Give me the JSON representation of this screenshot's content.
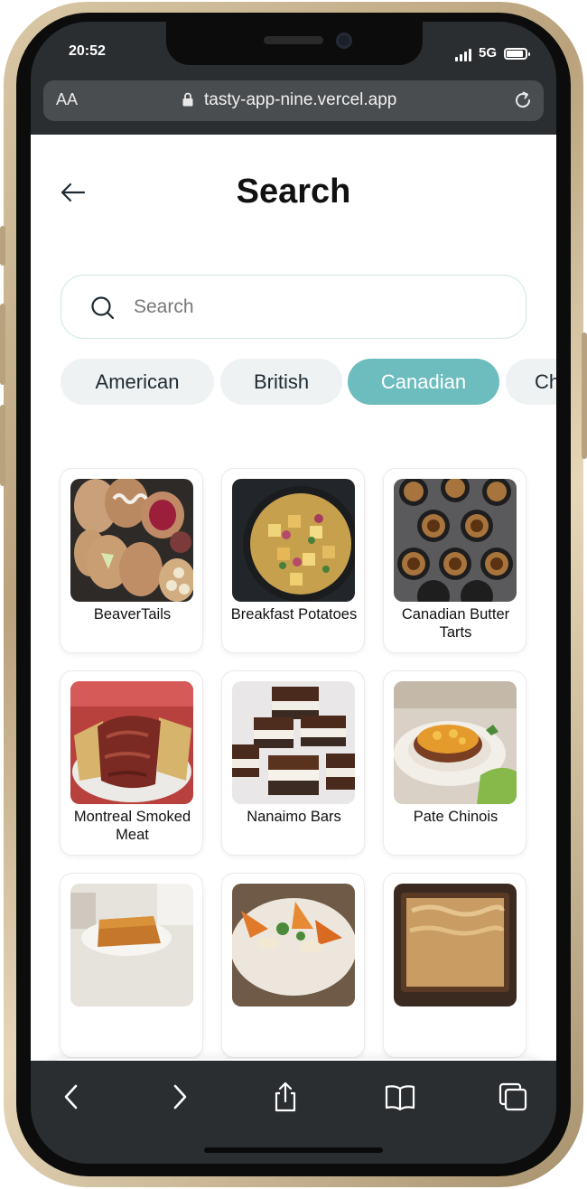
{
  "status_bar": {
    "time": "20:52",
    "network": "5G"
  },
  "browser": {
    "text_size_label": "AA",
    "url": "tasty-app-nine.vercel.app"
  },
  "page": {
    "title": "Search",
    "search_placeholder": "Search",
    "categories": [
      {
        "label": "American",
        "active": false
      },
      {
        "label": "British",
        "active": false
      },
      {
        "label": "Canadian",
        "active": true
      },
      {
        "label": "Chinese",
        "active": false
      }
    ],
    "meals": [
      {
        "name": "BeaverTails"
      },
      {
        "name": "Breakfast Potatoes"
      },
      {
        "name": "Canadian Butter Tarts"
      },
      {
        "name": "Montreal Smoked Meat"
      },
      {
        "name": "Nanaimo Bars"
      },
      {
        "name": "Pate Chinois"
      },
      {
        "name": ""
      },
      {
        "name": ""
      },
      {
        "name": ""
      }
    ]
  },
  "bottom_nav": [
    {
      "icon": "home-icon"
    },
    {
      "icon": "search-icon"
    },
    {
      "icon": "heart-icon"
    },
    {
      "icon": "profile-icon"
    }
  ],
  "safari_toolbar": [
    "back-icon",
    "forward-icon",
    "share-icon",
    "bookmarks-icon",
    "tabs-icon"
  ],
  "colors": {
    "accent": "#6dbcbe",
    "chip_bg": "#eef2f2",
    "browser_chrome": "#2b2e31"
  }
}
